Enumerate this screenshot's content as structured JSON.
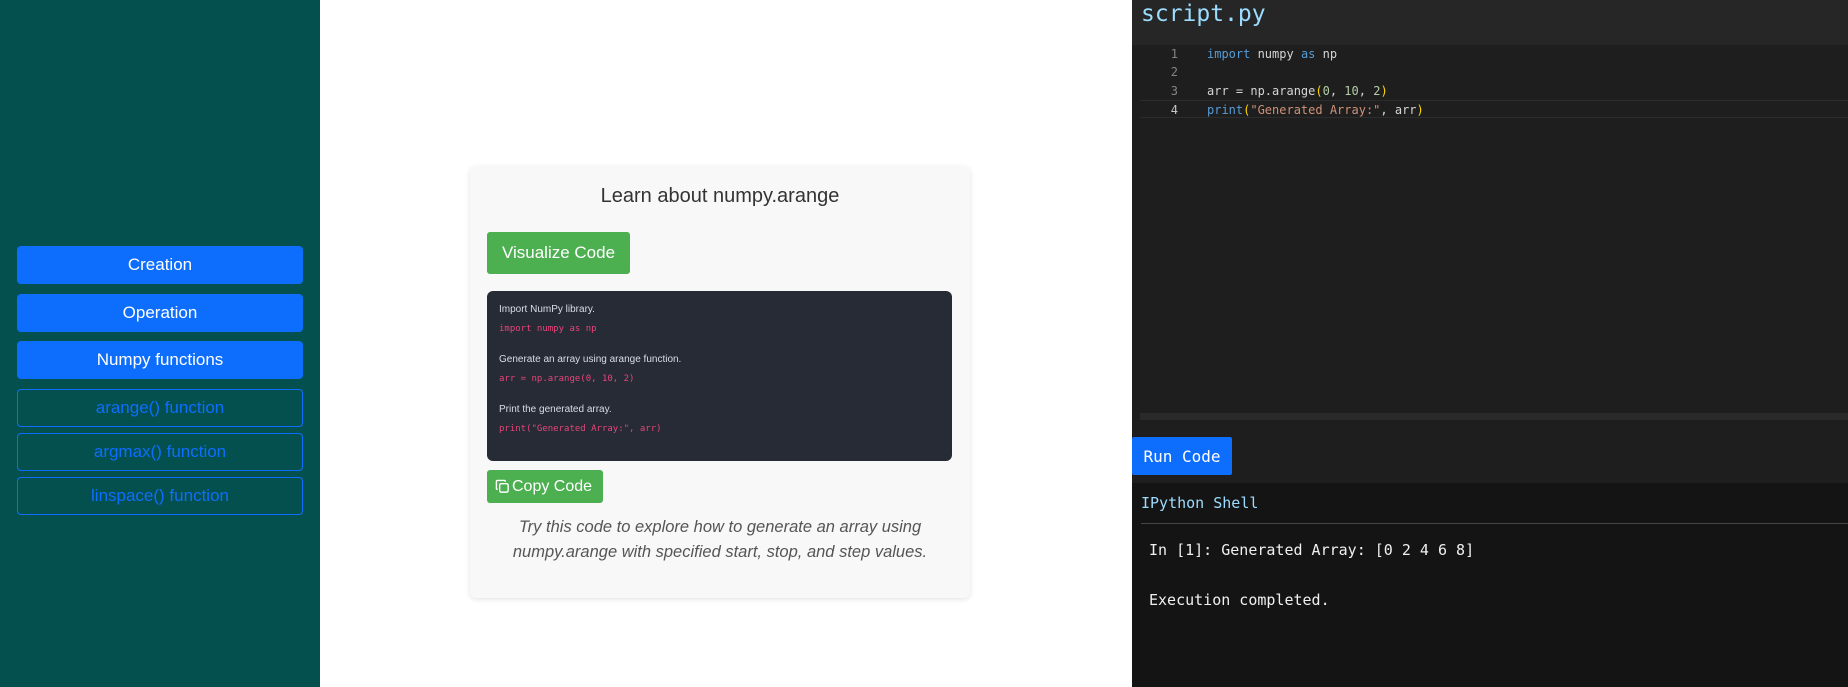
{
  "sidebar": {
    "items": [
      {
        "label": "Creation"
      },
      {
        "label": "Operation"
      },
      {
        "label": "Numpy functions"
      },
      {
        "label": "arange() function"
      },
      {
        "label": "argmax() function"
      },
      {
        "label": "linspace() function"
      }
    ]
  },
  "card": {
    "title": "Learn about numpy.arange",
    "visualize_label": "Visualize Code",
    "steps": [
      {
        "comment": "Import NumPy library.",
        "code": "import numpy as np"
      },
      {
        "comment": "Generate an array using arange function.",
        "code": "arr = np.arange(0, 10, 2)"
      },
      {
        "comment": "Print the generated array.",
        "code": "print(\"Generated Array:\", arr)"
      }
    ],
    "copy_label": "Copy Code",
    "description": "Try this code to explore how to generate an array using numpy.arange with specified start, stop, and step values."
  },
  "editor": {
    "filename": "script.py",
    "lines": [
      {
        "n": "1",
        "text": "import numpy as np"
      },
      {
        "n": "2",
        "text": ""
      },
      {
        "n": "3",
        "text": "arr = np.arange(0, 10, 2)"
      },
      {
        "n": "4",
        "text": "print(\"Generated Array:\", arr)"
      }
    ],
    "run_label": "Run Code"
  },
  "shell": {
    "title": "IPython Shell",
    "output": "In [1]: Generated Array: [0 2 4 6 8]",
    "status": "Execution completed."
  },
  "colors": {
    "sidebar_bg": "#03504f",
    "primary": "#0d6efd",
    "success": "#4caf50"
  }
}
